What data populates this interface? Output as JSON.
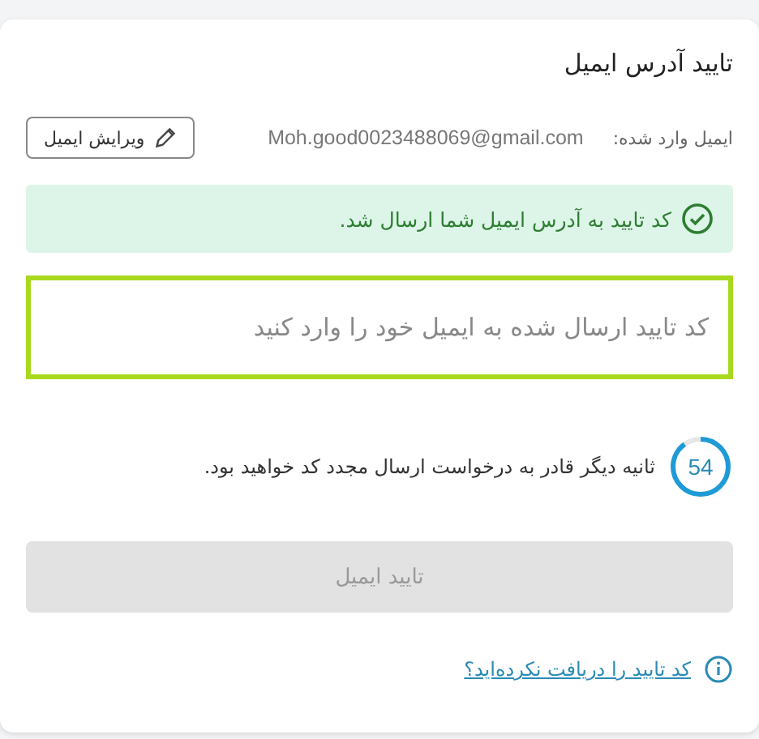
{
  "title": "تایید آدرس ایمیل",
  "email": {
    "label": "ایمیل وارد شده:",
    "value": "Moh.good0023488069@gmail.com",
    "edit_button": "ویرایش ایمیل"
  },
  "alert": {
    "kind": "success",
    "message": "کد تایید به آدرس ایمیل شما ارسال شد."
  },
  "code_field": {
    "placeholder": "کد تایید ارسال شده به ایمیل خود را وارد کنید",
    "focused": true
  },
  "countdown": {
    "value": "54",
    "level": 0.9,
    "message": "ثانیه دیگر قادر به درخواست ارسال مجدد کد خواهید بود."
  },
  "submit_button": {
    "label": "تایید ایمیل",
    "disabled": true
  },
  "help_link": "کد تایید را دریافت نکرده‌اید؟"
}
